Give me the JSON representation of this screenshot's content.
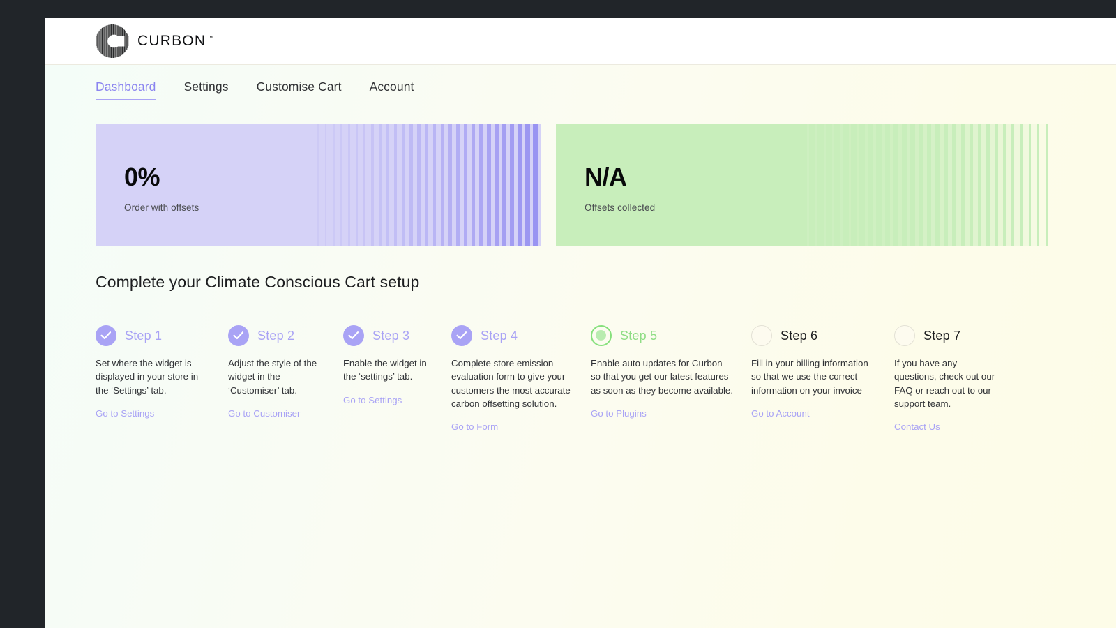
{
  "brand": {
    "name": "CURBON",
    "tm": "™",
    "logo_icon": "curbon-radial-c-logo"
  },
  "nav": {
    "tabs": [
      {
        "label": "Dashboard",
        "active": true
      },
      {
        "label": "Settings",
        "active": false
      },
      {
        "label": "Customise Cart",
        "active": false
      },
      {
        "label": "Account",
        "active": false
      }
    ]
  },
  "stats": [
    {
      "value": "0%",
      "label": "Order with offsets",
      "color": "#d5d2f7",
      "stripe_color": "#8b85f0"
    },
    {
      "value": "N/A",
      "label": "Offsets collected",
      "color": "#c8eebb",
      "stripe_color": "#fdfce8"
    }
  ],
  "setup": {
    "title": "Complete your Climate Conscious Cart setup",
    "steps": [
      {
        "title": "Step 1",
        "state": "done",
        "icon": "check-icon",
        "body": " Set where the widget is displayed in your store in the ‘Settings’ tab.",
        "link": "Go to Settings"
      },
      {
        "title": "Step 2",
        "state": "done",
        "icon": "check-icon",
        "body": "Adjust the style of the widget in the ‘Customiser’ tab.",
        "link": "Go to Customiser"
      },
      {
        "title": "Step 3",
        "state": "done",
        "icon": "check-icon",
        "body": "Enable the widget in the ‘settings’ tab.",
        "link": "Go to Settings"
      },
      {
        "title": "Step 4",
        "state": "done",
        "icon": "check-icon",
        "body": "Complete store emission evaluation form to give your customers the most accurate carbon offsetting solution.",
        "link": "Go to Form"
      },
      {
        "title": "Step 5",
        "state": "current",
        "icon": "radio-filled-icon",
        "body": "Enable auto updates for Curbon so that you get our latest features as soon as they become available.",
        "link": "Go to Plugins"
      },
      {
        "title": "Step 6",
        "state": "todo",
        "icon": "circle-empty-icon",
        "body": "Fill in your billing information so that we use the correct information on your invoice",
        "link": "Go to Account"
      },
      {
        "title": "Step 7",
        "state": "todo",
        "icon": "circle-empty-icon",
        "body": "If you have any questions, check out our FAQ or reach out to our support team.",
        "link": "Contact Us"
      }
    ]
  },
  "theme": {
    "accent_purple": "#a9a3f5",
    "accent_green": "#86e07c",
    "chrome_dark": "#212529",
    "page_bg_left": "#f4fdf8",
    "page_bg_right": "#fdfce8"
  }
}
